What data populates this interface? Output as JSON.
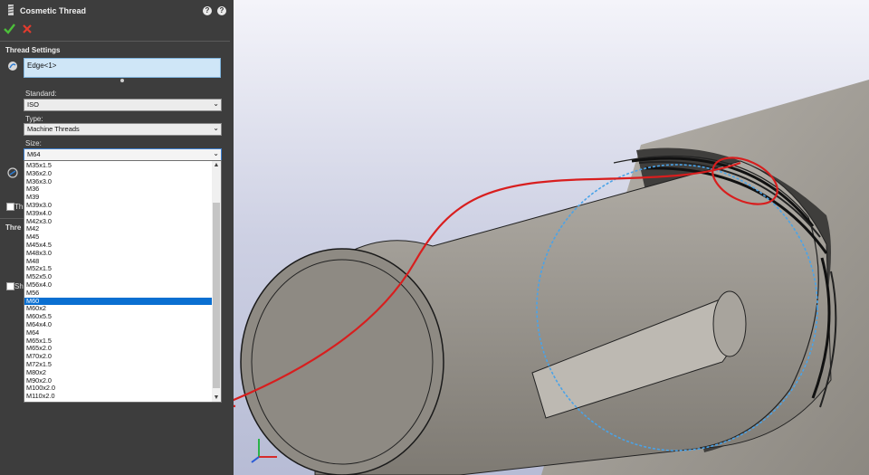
{
  "panel": {
    "title": "Cosmetic Thread",
    "help_labels": [
      "?",
      "?"
    ],
    "thread_settings": {
      "section_title": "Thread Settings",
      "edge_value": "Edge<1>",
      "standard_label": "Standard:",
      "standard_value": "ISO",
      "type_label": "Type:",
      "type_value": "Machine Threads",
      "size_label": "Size:",
      "size_value": "M64"
    },
    "cut_off": {
      "checkbox1_text": "Thr",
      "section2_text": "Thre",
      "checkbox2_text": "Sho"
    }
  },
  "size_dropdown": {
    "selected": "M60",
    "scroll_up": "▲",
    "scroll_down": "▼",
    "options": [
      "M35x1.5",
      "M36x2.0",
      "M36x3.0",
      "M36",
      "M39",
      "M39x3.0",
      "M39x4.0",
      "M42x3.0",
      "M42",
      "M45",
      "M45x4.5",
      "M48x3.0",
      "M48",
      "M52x1.5",
      "M52x5.0",
      "M56x4.0",
      "M56",
      "M60",
      "M60x2",
      "M60x5.5",
      "M64x4.0",
      "M64",
      "M65x1.5",
      "M65x2.0",
      "M70x2.0",
      "M72x1.5",
      "M80x2",
      "M90x2.0",
      "M100x2.0",
      "M110x2.0"
    ]
  },
  "colors": {
    "panel_bg": "#3d3d3d",
    "selection_blue": "#0a6fd1",
    "annotation_red": "#d81e1e",
    "preview_dash": "#4aa3e8"
  },
  "icons": {
    "ok": "checkmark-icon",
    "cancel": "close-icon",
    "help": "help-icon",
    "edge": "edge-select-icon",
    "feature": "thread-feature-icon"
  }
}
